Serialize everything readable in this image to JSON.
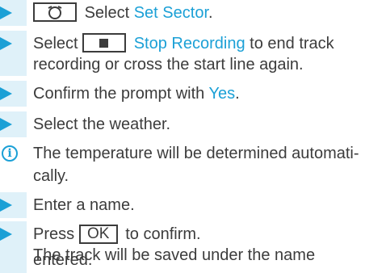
{
  "steps": [
    {
      "type": "step",
      "key_label": "",
      "text_before": "",
      "link": "Set Sector",
      "text_after": "."
    },
    {
      "type": "step",
      "key_label": "",
      "text_before": "Select",
      "link": "Stop Recording",
      "text_after": "to end track",
      "line2": "recording or cross the start line again."
    },
    {
      "type": "step",
      "text_before": "Confirm the prompt with",
      "link": "Yes",
      "text_after": "."
    },
    {
      "type": "step",
      "text": "Select the weather."
    },
    {
      "type": "info",
      "line1": "The temperature will be determined automati-",
      "line2": "cally."
    },
    {
      "type": "step",
      "text": "Enter a name."
    },
    {
      "type": "step",
      "text_before": "Press",
      "key_label": "OK",
      "text_after": "to confirm.",
      "line2": "The track will be saved under the name",
      "line3": "entered."
    }
  ],
  "step1_select_word": "Select",
  "colors": {
    "accent": "#1ba0d6",
    "bar": "#dff1f9",
    "text": "#3c3c3c"
  },
  "icons": {
    "step_marker": "triangle-right-icon",
    "info": "info-circle-icon",
    "rotary": "rotary-controller-icon",
    "stop": "stop-square-icon"
  }
}
